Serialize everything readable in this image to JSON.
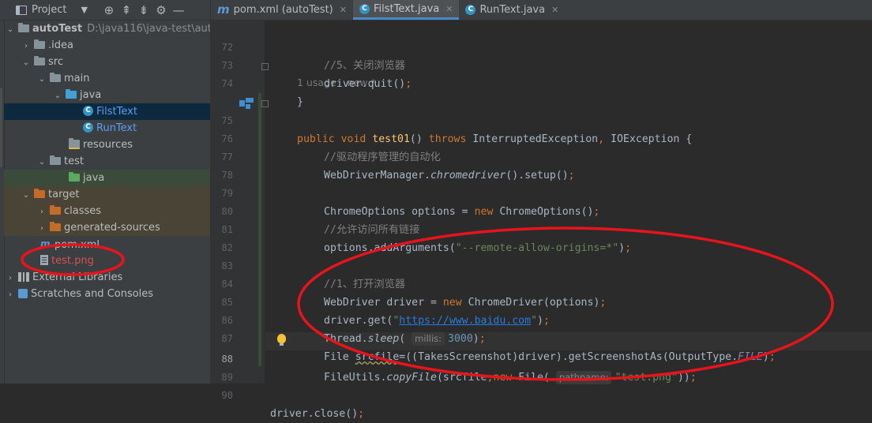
{
  "project_panel": {
    "title": "Project",
    "tree": [
      {
        "label": "autoTest",
        "path": "D:\\java116\\java-test\\auto"
      },
      {
        "label": ".idea"
      },
      {
        "label": "src"
      },
      {
        "label": "main"
      },
      {
        "label": "java"
      },
      {
        "label": "FilstText"
      },
      {
        "label": "RunText"
      },
      {
        "label": "resources"
      },
      {
        "label": "test"
      },
      {
        "label": "java"
      },
      {
        "label": "target"
      },
      {
        "label": "classes"
      },
      {
        "label": "generated-sources"
      },
      {
        "label": "pom.xml"
      },
      {
        "label": "test.png"
      },
      {
        "label": "External Libraries"
      },
      {
        "label": "Scratches and Consoles"
      }
    ]
  },
  "tabs": [
    {
      "label": "pom.xml (autoTest)",
      "icon": "maven-icon",
      "active": false
    },
    {
      "label": "FilstText.java",
      "icon": "java-class-icon",
      "active": true
    },
    {
      "label": "RunText.java",
      "icon": "java-class-icon",
      "active": false
    }
  ],
  "editor": {
    "usage_hint": {
      "usages": "1 usage",
      "author": "new *"
    },
    "lines": [
      {
        "n": "72",
        "text": "//5、关闭浏览器"
      },
      {
        "n": "73",
        "text": "driver.quit();"
      },
      {
        "n": "74",
        "text": "}"
      },
      {
        "n": "75",
        "text": "public void test01() throws InterruptedException, IOException {"
      },
      {
        "n": "76",
        "text": "//驱动程序管理的自动化"
      },
      {
        "n": "77",
        "text": "WebDriverManager.chromedriver().setup();"
      },
      {
        "n": "78",
        "text": ""
      },
      {
        "n": "79",
        "text": "ChromeOptions options = new ChromeOptions();"
      },
      {
        "n": "80",
        "text": "//允许访问所有链接"
      },
      {
        "n": "81",
        "text": "options.addArguments(\"--remote-allow-origins=*\");"
      },
      {
        "n": "82",
        "text": ""
      },
      {
        "n": "83",
        "text": "//1、打开浏览器"
      },
      {
        "n": "84",
        "text": "WebDriver driver = new ChromeDriver(options);"
      },
      {
        "n": "85",
        "text": "driver.get(\"https://www.baidu.com\");"
      },
      {
        "n": "86",
        "text": "Thread.sleep( millis: 3000);"
      },
      {
        "n": "87",
        "text": "File srcfile=((TakesScreenshot)driver).getScreenshotAs(OutputType.FILE);"
      },
      {
        "n": "88",
        "text": "FileUtils.copyFile(srcfile,new File( pathname: \"test.png\"));"
      },
      {
        "n": "89",
        "text": ""
      },
      {
        "n": "90",
        "text": "driver.close();"
      }
    ]
  },
  "colors": {
    "annotation_red": "#e8141c",
    "keyword": "#cc7832",
    "string": "#6a8759",
    "number": "#6897bb",
    "method_decl": "#ffc66d",
    "comment": "#808080"
  }
}
